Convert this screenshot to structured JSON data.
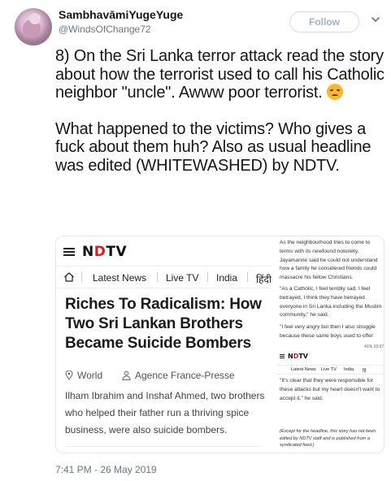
{
  "author": {
    "display_name": "SambhavāmiYugeYuge",
    "handle": "@WindsOfChange72"
  },
  "follow_button": {
    "label": "Follow"
  },
  "tweet": {
    "paragraph1": "8) On the Sri Lanka terror attack read the story about how the terrorist used to call his Catholic neighbor \"uncle\". Awww poor terrorist.",
    "paragraph2": "What happened to the victims? Who gives a fuck about them huh? Also as usual headline was edited (WHITEWASHED) by NDTV.",
    "emoji": "disappointed-face-emoji",
    "timestamp": "7:41 PM - 26 May 2019"
  },
  "screenshot_left": {
    "logo_left": "N",
    "logo_red": "D",
    "logo_right": "TV",
    "nav": {
      "latest_news": "Latest News",
      "live_tv": "Live TV",
      "india": "India",
      "hindi": "हिंदी"
    },
    "headline": "Riches To Radicalism: How Two Sri Lankan Brothers Became Suicide Bombers",
    "meta_world": "World",
    "meta_agency": "Agence France-Presse",
    "summary": "Ilham Ibrahim and Inshaf Ahmed, two brothers who helped their father run a thriving spice business, were also suicide bombers."
  },
  "screenshot_right": {
    "p1": "As the neighbourhood tries to come to terms with its newfound notoriety, Jayamanne said he could not understand how a family he considered friends could massacre his fellow Christians.",
    "p2": "\"As a Catholic, I feel terribly sad. I feel betrayed, I think they have betrayed everyone in Sri Lanka including the Muslim community,\" he said.",
    "p3": "\"I feel very angry but then I also struggle because these same boys used to offer",
    "status_bar": "41% 19:37",
    "logo_left": "N",
    "logo_red": "D",
    "logo_right": "TV",
    "nav": {
      "latest_news": "Latest News",
      "live_tv": "Live TV",
      "india": "India",
      "hindi": "हिं"
    },
    "p4": "\"It's clear that they were responsible for these attacks but my heart doesn't want to accept it,\" he said.",
    "note": "(Except for the headline, this story has not been edited by NDTV staff and is published from a syndicated feed.)"
  }
}
